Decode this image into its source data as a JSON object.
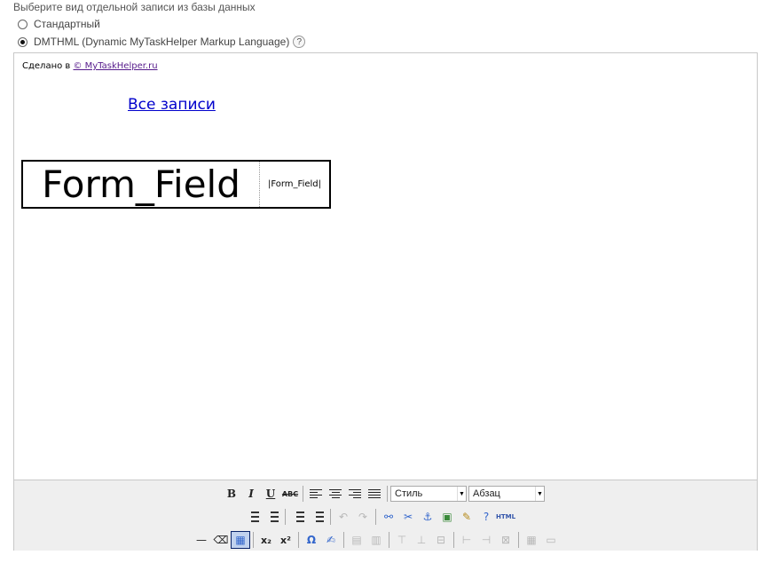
{
  "heading": "Выберите вид отдельной записи из базы данных",
  "options": [
    {
      "label": "Стандартный",
      "checked": false
    },
    {
      "label": "DMTHML (Dynamic MyTaskHelper Markup Language)",
      "checked": true
    }
  ],
  "help_symbol": "?",
  "editor": {
    "made_in_prefix": "Сделано в",
    "made_in_link": "© MyTaskHelper.ru",
    "all_records_link": "Все записи",
    "field_big": "Form_Field",
    "field_small": "|Form_Field|"
  },
  "toolbar": {
    "bold": "B",
    "italic": "I",
    "underline": "U",
    "strike": "ABC",
    "style_select": "Стиль",
    "format_select": "Абзац",
    "undo": "↶",
    "redo": "↷",
    "link": "⚯",
    "unlink": "✂",
    "anchor": "⚓",
    "image": "▣",
    "cleanup": "✎",
    "help": "?",
    "html": "HTML",
    "hr": "—",
    "eraser": "⌫",
    "table": "▦",
    "subscript": "x₂",
    "superscript": "x²",
    "omega": "Ω",
    "edit": "✍",
    "row_props": "▤",
    "cell_props": "▥",
    "insert_row_before": "⊤",
    "insert_row_after": "⊥",
    "delete_row": "⊟",
    "insert_col_before": "⊢",
    "insert_col_after": "⊣",
    "delete_col": "⊠",
    "split_cells": "▦",
    "merge_cells": "▭"
  }
}
